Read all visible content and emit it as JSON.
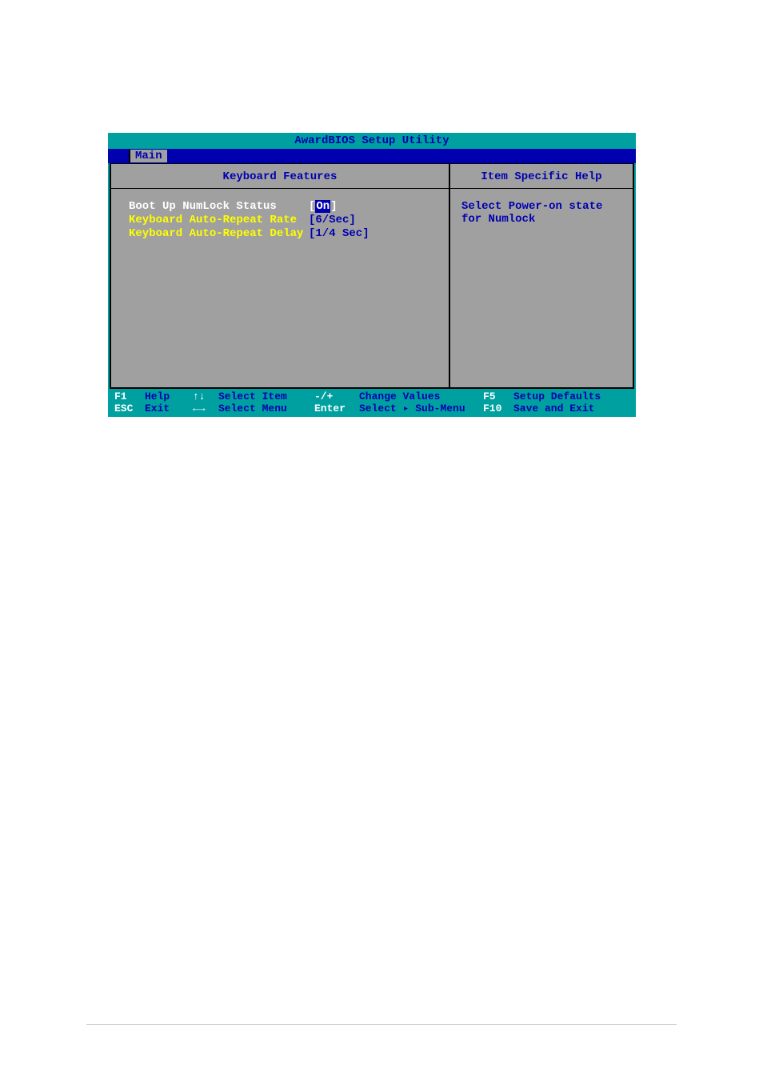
{
  "title": "AwardBIOS Setup Utility",
  "menu": {
    "active_tab": "Main"
  },
  "panel": {
    "left_header": "Keyboard Features",
    "right_header": "Item Specific Help",
    "help_text_line1": "Select Power-on state",
    "help_text_line2": "for Numlock"
  },
  "settings": [
    {
      "label": "Boot Up NumLock Status",
      "value": "On",
      "selected": true
    },
    {
      "label": "Keyboard Auto-Repeat Rate",
      "value": "[6/Sec]",
      "selected": false
    },
    {
      "label": "Keyboard Auto-Repeat Delay",
      "value": "[1/4 Sec]",
      "selected": false
    }
  ],
  "footer": {
    "row1": {
      "key1": "F1",
      "action1": "Help",
      "arrow1": "↑↓",
      "select1": "Select Item",
      "pm1": "-/+",
      "change1": "Change Values",
      "fkey1": "F5",
      "defaults1": "Setup Defaults"
    },
    "row2": {
      "key2": "ESC",
      "action2": "Exit",
      "arrow2": "←→",
      "select2": "Select Menu",
      "pm2": "Enter",
      "change2": "Select ▸ Sub-Menu",
      "fkey2": "F10",
      "defaults2": "Save and Exit"
    }
  }
}
